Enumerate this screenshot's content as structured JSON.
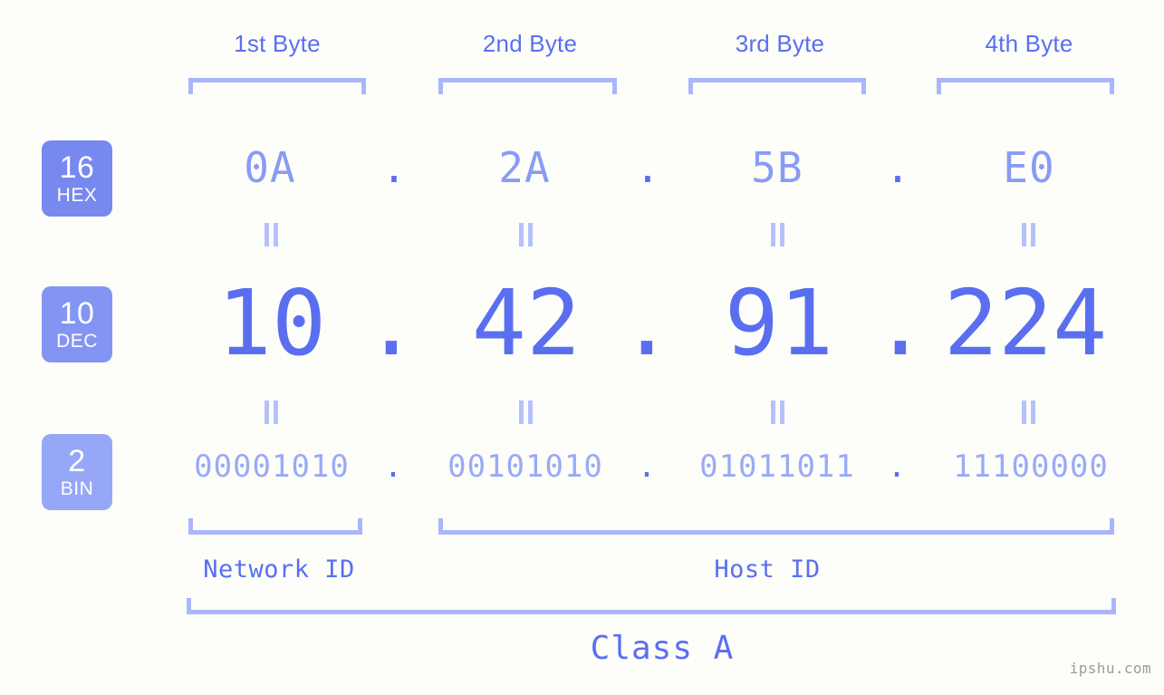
{
  "meta": {
    "watermark": "ipshu.com"
  },
  "header": {
    "byte_labels": [
      {
        "label": "1st Byte"
      },
      {
        "label": "2nd Byte"
      },
      {
        "label": "3rd Byte"
      },
      {
        "label": "4th Byte"
      }
    ]
  },
  "bases": [
    {
      "number": "16",
      "name": "HEX",
      "color": "#7788ef"
    },
    {
      "number": "10",
      "name": "DEC",
      "color": "#8494f3"
    },
    {
      "number": "2",
      "name": "BIN",
      "color": "#96a7f8"
    }
  ],
  "rows": {
    "hex": {
      "base_number": "16",
      "base_name": "HEX",
      "octets": [
        "0A",
        "2A",
        "5B",
        "E0"
      ],
      "separator": "."
    },
    "dec": {
      "base_number": "10",
      "base_name": "DEC",
      "octets": [
        "10",
        "42",
        "91",
        "224"
      ],
      "separator": "."
    },
    "bin": {
      "base_number": "2",
      "base_name": "BIN",
      "octets": [
        "00001010",
        "00101010",
        "01011011",
        "11100000"
      ],
      "separator": "."
    }
  },
  "equality_symbol": "=",
  "footer": {
    "network_id_label": "Network ID",
    "host_id_label": "Host ID",
    "class_label": "Class A"
  },
  "colors": {
    "background": "#fdfefa",
    "accent_strong": "#5a6ff0",
    "accent_mid": "#8a9bf5",
    "accent_light": "#aab6fb",
    "bracket": "#aab6fb",
    "watermark": "#9a9a9a"
  }
}
